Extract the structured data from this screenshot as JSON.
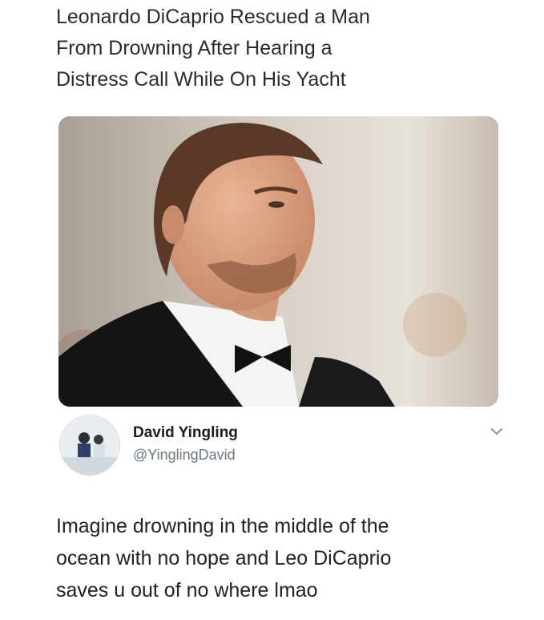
{
  "headline": {
    "lines": [
      "Leonardo DiCaprio Rescued a Man",
      "From Drowning After Hearing a",
      "Distress Call While On His Yacht"
    ]
  },
  "photo": {
    "alt": ""
  },
  "tweet": {
    "author_name": "David Yingling",
    "author_handle": "@YinglingDavid",
    "body_lines": [
      "Imagine drowning in the middle of the",
      "ocean with no hope and Leo DiCaprio",
      "saves u out of no where lmao"
    ],
    "menu_icon": "chevron-down-icon"
  },
  "colors": {
    "text": "#222222",
    "handle": "#6b7780"
  }
}
